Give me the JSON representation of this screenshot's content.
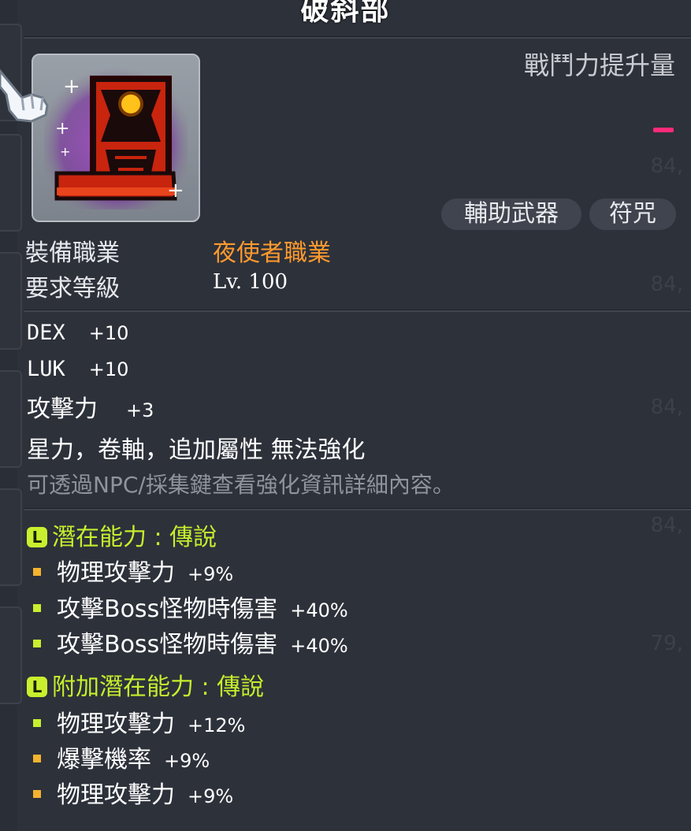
{
  "item": {
    "name": "破斜部",
    "cp_label": "戰鬥力提升量",
    "categories": [
      "輔助武器",
      "符咒"
    ]
  },
  "requirements": {
    "job_label": "裝備職業",
    "job_value": "夜使者職業",
    "level_label": "要求等級",
    "level_value": "Lv. 100"
  },
  "stats": [
    {
      "name": "DEX",
      "value": "+10"
    },
    {
      "name": "LUK",
      "value": "+10"
    },
    {
      "name": "攻擊力",
      "value": "+3"
    }
  ],
  "enhance": {
    "note": "星力，卷軸，追加屬性 無法強化",
    "hint": "可透過NPC/採集鍵查看強化資訊詳細內容。"
  },
  "potential": {
    "badge": "L",
    "title": "潛在能力 : 傳說",
    "lines": [
      {
        "text": "物理攻擊力",
        "value": "+9%",
        "color": "#f5b32e"
      },
      {
        "text": "攻擊Boss怪物時傷害",
        "value": "+40%",
        "color": "#c8f02e"
      },
      {
        "text": "攻擊Boss怪物時傷害",
        "value": "+40%",
        "color": "#c8f02e"
      }
    ]
  },
  "additional_potential": {
    "badge": "L",
    "title": "附加潛在能力 : 傳說",
    "lines": [
      {
        "text": "物理攻擊力",
        "value": "+12%",
        "color": "#c8f02e"
      },
      {
        "text": "爆擊機率",
        "value": "+9%",
        "color": "#f5b32e"
      },
      {
        "text": "物理攻擊力",
        "value": "+9%",
        "color": "#f5b32e"
      }
    ]
  },
  "colors": {
    "job": "#ff9a2e",
    "potential_title": "#c5ee2c",
    "cp_dash": "#ff2b7a"
  }
}
